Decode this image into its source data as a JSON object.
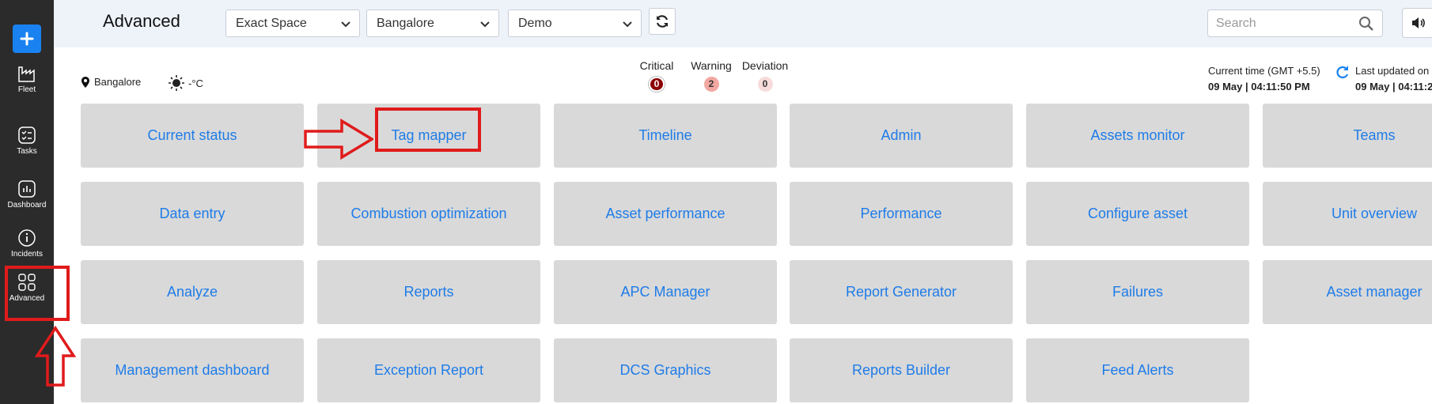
{
  "app": {
    "page_title": "Advanced"
  },
  "sidebar": {
    "items": [
      {
        "label": "Fleet",
        "icon": "factory-icon"
      },
      {
        "label": "Tasks",
        "icon": "tasks-icon"
      },
      {
        "label": "Dashboard",
        "icon": "dashboard-icon"
      },
      {
        "label": "Incidents",
        "icon": "info-icon"
      },
      {
        "label": "Advanced",
        "icon": "grid-icon"
      }
    ]
  },
  "header": {
    "selects": [
      {
        "value": "Exact Space"
      },
      {
        "value": "Bangalore"
      },
      {
        "value": "Demo"
      }
    ],
    "search": {
      "placeholder": "Search"
    }
  },
  "info": {
    "location": "Bangalore",
    "temperature": "-°C",
    "alerts": [
      {
        "label": "Critical",
        "count": "0"
      },
      {
        "label": "Warning",
        "count": "2"
      },
      {
        "label": "Deviation",
        "count": "0"
      }
    ],
    "current_time_label": "Current time (GMT +5.5)",
    "current_time_value": "09 May | 04:11:50 PM",
    "last_updated_label": "Last updated on",
    "last_updated_value": "09 May | 04:11:2"
  },
  "tiles": [
    "Current status",
    "Tag mapper",
    "Timeline",
    "Admin",
    "Assets monitor",
    "Teams",
    "Data entry",
    "Combustion optimization",
    "Asset performance",
    "Performance",
    "Configure asset",
    "Unit overview",
    "Analyze",
    "Reports",
    "APC Manager",
    "Report Generator",
    "Failures",
    "Asset manager",
    "Management dashboard",
    "Exception Report",
    "DCS Graphics",
    "Reports Builder",
    "Feed Alerts"
  ],
  "colors": {
    "accent": "#1a82f0",
    "tile_text": "#1e7ce8",
    "annotation": "#e01b1b"
  }
}
